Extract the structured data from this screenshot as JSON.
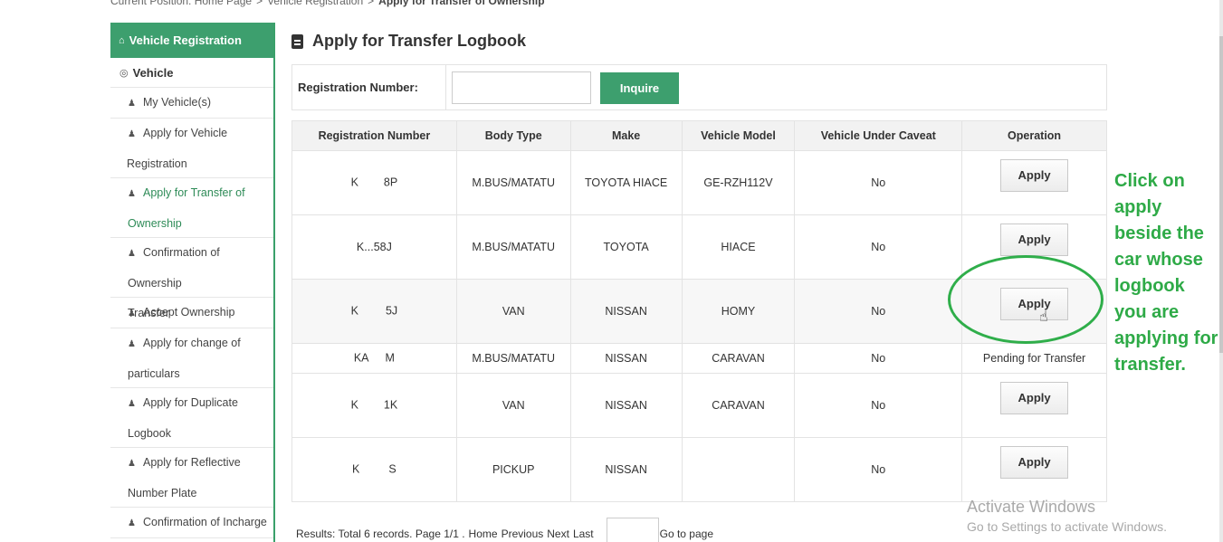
{
  "breadcrumb": {
    "prefix": "Current Position: Home Page",
    "sep1": ">",
    "middle": "Vehicle Registration",
    "sep2": ">",
    "current": "Apply for Transfer of Ownership"
  },
  "sidebar": {
    "header": "Vehicle Registration",
    "section": "Vehicle",
    "items": [
      {
        "line1": "My Vehicle(s)",
        "line2": ""
      },
      {
        "line1": "Apply for Vehicle",
        "line2": "Registration"
      },
      {
        "line1": "Apply for Transfer of",
        "line2": "Ownership"
      },
      {
        "line1": "Confirmation of Ownership",
        "line2": "Transfer"
      },
      {
        "line1": "Accept Ownership",
        "line2": ""
      },
      {
        "line1": "Apply for change of",
        "line2": "particulars"
      },
      {
        "line1": "Apply for Duplicate",
        "line2": "Logbook"
      },
      {
        "line1": "Apply for Reflective",
        "line2": "Number Plate"
      },
      {
        "line1": "Confirmation of Incharge",
        "line2": ""
      }
    ]
  },
  "page_title": "Apply for Transfer Logbook",
  "search": {
    "label": "Registration Number:",
    "value": "",
    "button": "Inquire"
  },
  "table": {
    "headers": [
      "Registration Number",
      "Body Type",
      "Make",
      "Vehicle Model",
      "Vehicle Under Caveat",
      "Operation"
    ],
    "rows": [
      {
        "reg_a": "K",
        "reg_b": "8P",
        "body": "M.BUS/MATATU",
        "make": "TOYOTA HIACE",
        "model": "GE-RZH112V",
        "caveat": "No",
        "op": "Apply"
      },
      {
        "reg_a": "K...",
        "reg_b": "58J",
        "body": "M.BUS/MATATU",
        "make": "TOYOTA",
        "model": "HIACE",
        "caveat": "No",
        "op": "Apply"
      },
      {
        "reg_a": "K",
        "reg_b": "5J",
        "body": "VAN",
        "make": "NISSAN",
        "model": "HOMY",
        "caveat": "No",
        "op": "Apply"
      },
      {
        "reg_a": "KA",
        "reg_b": "M",
        "body": "M.BUS/MATATU",
        "make": "NISSAN",
        "model": "CARAVAN",
        "caveat": "No",
        "op": "Pending for Transfer"
      },
      {
        "reg_a": "K",
        "reg_b": "1K",
        "body": "VAN",
        "make": "NISSAN",
        "model": "CARAVAN",
        "caveat": "No",
        "op": "Apply"
      },
      {
        "reg_a": "K",
        "reg_b": "S",
        "body": "PICKUP",
        "make": "NISSAN",
        "model": "",
        "caveat": "No",
        "op": "Apply"
      }
    ]
  },
  "pager": {
    "results": "Results: Total 6 records. Page 1/1 .",
    "home": "Home",
    "previous": "Previous",
    "next": "Next",
    "last": "Last",
    "goto": "Go to page"
  },
  "annotation": "Click on apply beside the car whose logbook you are applying for transfer.",
  "watermark": {
    "line1": "Activate Windows",
    "line2": "Go to Settings to activate Windows."
  },
  "colors": {
    "brand_green": "#3d9f6e",
    "annotation_green": "#2eaa47"
  }
}
